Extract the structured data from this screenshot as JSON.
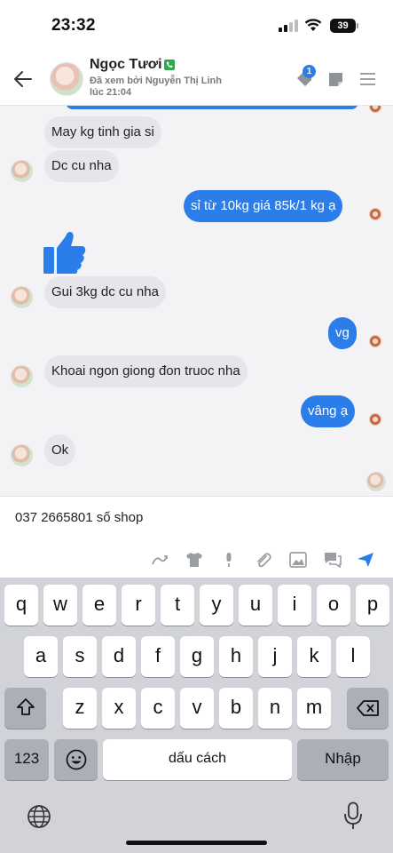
{
  "status": {
    "time": "23:32",
    "battery": "39"
  },
  "header": {
    "contact_name": "Ngọc Tươi",
    "seen_line": "Đã xem bởi Nguyễn Thị Linh",
    "seen_time": "lúc 21:04",
    "tag_count": "1"
  },
  "messages": [
    {
      "dir": "in",
      "text": "May kg tinh gia si"
    },
    {
      "dir": "in",
      "text": "Dc cu nha"
    },
    {
      "dir": "out",
      "text": "sỉ từ 10kg giá 85k/1 kg ạ"
    },
    {
      "dir": "in",
      "text": "Gui 3kg dc cu nha"
    },
    {
      "dir": "out",
      "text": "vg"
    },
    {
      "dir": "in",
      "text": "Khoai ngon giong đon truoc nha"
    },
    {
      "dir": "out",
      "text": "vâng ạ"
    },
    {
      "dir": "in",
      "text": "Ok"
    }
  ],
  "composer": {
    "text": "037 2665801 số shop"
  },
  "keyboard": {
    "row1": [
      "q",
      "w",
      "e",
      "r",
      "t",
      "y",
      "u",
      "i",
      "o",
      "p"
    ],
    "row2": [
      "a",
      "s",
      "d",
      "f",
      "g",
      "h",
      "j",
      "k",
      "l"
    ],
    "row3": [
      "z",
      "x",
      "c",
      "v",
      "b",
      "n",
      "m"
    ],
    "numbers_label": "123",
    "space_label": "dấu cách",
    "return_label": "Nhập"
  }
}
